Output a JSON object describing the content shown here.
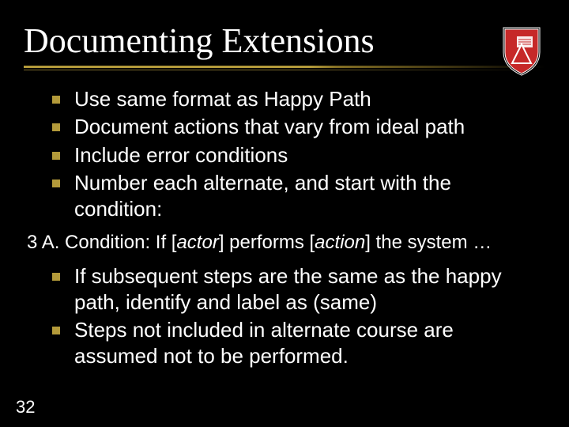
{
  "title": "Documenting Extensions",
  "bullets_top": [
    "Use same format as Happy Path",
    "Document actions that vary from ideal path",
    "Include error conditions",
    "Number each alternate, and start with the condition:"
  ],
  "condition": {
    "prefix": "3 A. Condition: If [",
    "actor": "actor",
    "mid": "] performs [",
    "action": "action",
    "suffix": "] the system …"
  },
  "bullets_bottom": [
    "If subsequent steps are the same as the happy path, identify and label as (same)",
    "Steps not included in alternate course are assumed not to be performed."
  ],
  "page_number": "32"
}
